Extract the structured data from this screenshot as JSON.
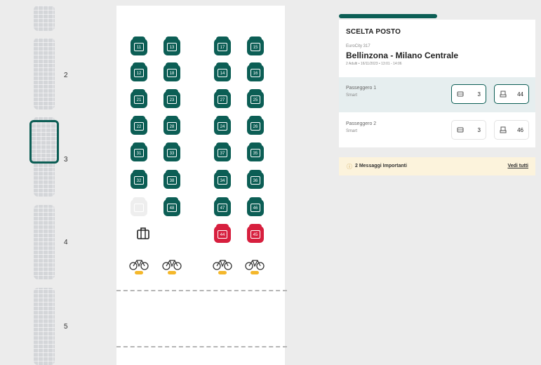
{
  "cars": [
    {
      "label": "",
      "selected": false
    },
    {
      "label": "2",
      "selected": false
    },
    {
      "label": "3",
      "selected": true
    },
    {
      "label": "4",
      "selected": false
    },
    {
      "label": "5",
      "selected": false
    }
  ],
  "seats": {
    "rows": [
      [
        "11",
        "13",
        "17",
        "15"
      ],
      [
        "12",
        "18",
        "14",
        "16"
      ],
      [
        "21",
        "23",
        "27",
        "25"
      ],
      [
        "22",
        "28",
        "24",
        "26"
      ],
      [
        "31",
        "33",
        "37",
        "35"
      ],
      [
        "32",
        "38",
        "34",
        "36"
      ],
      [
        "",
        "48",
        "47",
        "46"
      ]
    ],
    "reserved": [
      "44",
      "45"
    ]
  },
  "progress": {
    "fraction": 0.5
  },
  "panel": {
    "title": "SCELTA POSTO",
    "train_code": "EuroCity 317",
    "route": "Bellinzona - Milano Centrale",
    "trip_meta": "2 Adulti • 16/11/2023 • 13:01 - 14:06",
    "passengers": [
      {
        "name": "Passeggero 1",
        "tariff": "Smart",
        "car": "3",
        "seat": "44",
        "active": true
      },
      {
        "name": "Passeggero 2",
        "tariff": "Smart",
        "car": "3",
        "seat": "46",
        "active": false
      }
    ]
  },
  "messages": {
    "icon": "info-icon",
    "text": "2 Messaggi Importanti",
    "link": "Vedi tutti"
  },
  "colors": {
    "accent": "#0c5e55",
    "reserved": "#d71f3e",
    "bike_tag": "#f4b72b",
    "message_bg": "#fcf3dc"
  }
}
